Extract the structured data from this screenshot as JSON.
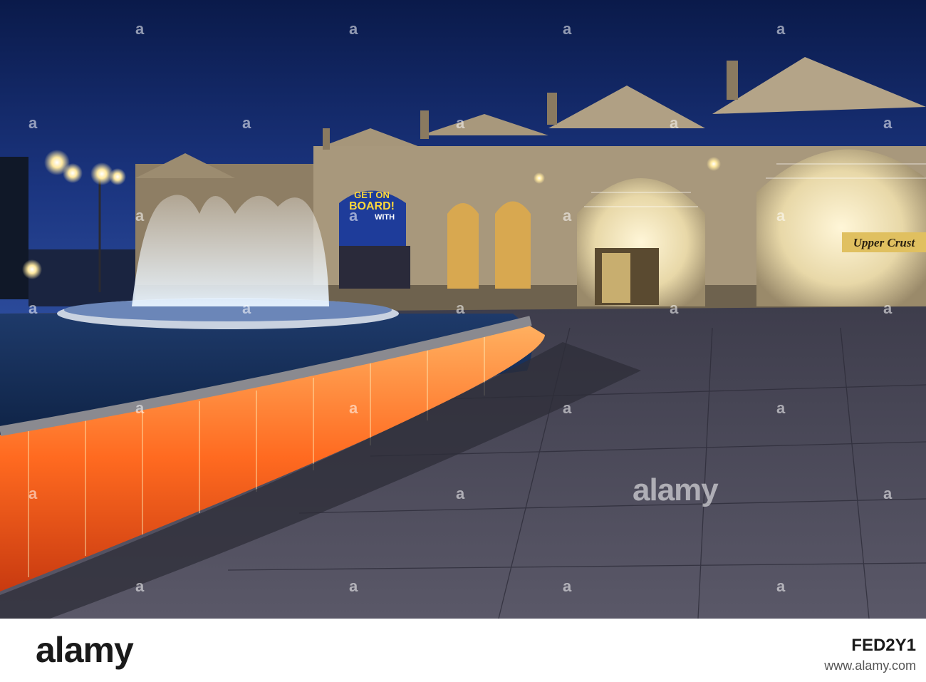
{
  "poster": {
    "line1": "GET ON",
    "line2": "BOARD!",
    "line3": "WITH"
  },
  "shop_sign": "Upper Crust",
  "watermark": {
    "large": "alamy",
    "tile": "a"
  },
  "footer": {
    "logo": "alamy",
    "image_id": "FED2Y1",
    "url": "www.alamy.com"
  },
  "colors": {
    "sky_top": "#0a1a4a",
    "sky_bottom": "#2b4a9a",
    "stone": "#b8a88c",
    "warm_light": "#ffd27a",
    "fountain_orange": "#ff6a20",
    "pavement": "#4a4858"
  }
}
